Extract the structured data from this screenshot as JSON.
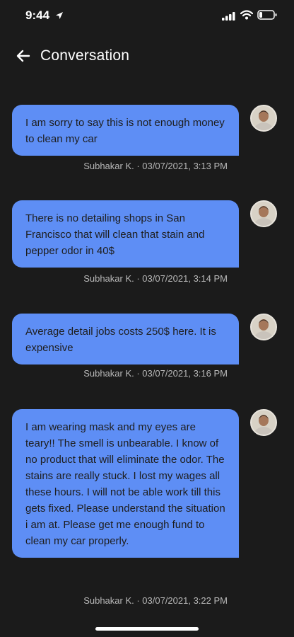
{
  "status_bar": {
    "time": "9:44"
  },
  "header": {
    "title": "Conversation"
  },
  "messages": [
    {
      "text": "I am sorry to say this is not enough money to clean my car",
      "meta": "Subhakar K. · 03/07/2021, 3:13 PM"
    },
    {
      "text": "There is no detailing shops in San Francisco that will clean that stain and pepper odor in 40$",
      "meta": "Subhakar K. · 03/07/2021, 3:14 PM"
    },
    {
      "text": "Average detail jobs costs 250$ here. It is expensive",
      "meta": "Subhakar K. · 03/07/2021, 3:16 PM"
    },
    {
      "text": "I am wearing mask and my eyes are teary!! The smell is unbearable. I know of no product that will eliminate the odor. The stains are really stuck. I lost my wages all these hours. I will not be able work till this gets fixed. Please understand the situation i am at. Please get me enough fund to clean my car properly.",
      "meta": "Subhakar K. · 03/07/2021, 3:22 PM"
    }
  ],
  "colors": {
    "background": "#1b1b1b",
    "bubble": "#5e8ef5",
    "meta_text": "#b8b8b8"
  }
}
